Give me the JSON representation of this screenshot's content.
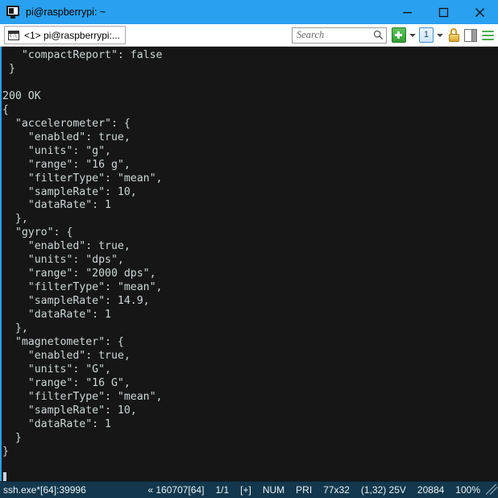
{
  "window": {
    "title": "pi@raspberrypi: ~",
    "icon": "conemu-monitor-icon",
    "minimize_label": "Minimize",
    "maximize_label": "Maximize",
    "close_label": "Close"
  },
  "tabs": [
    {
      "label": "<1> pi@raspberrypi:...",
      "icon": "console-icon",
      "active": true
    }
  ],
  "toolbar": {
    "search": {
      "placeholder": "Search",
      "value": "",
      "icon": "search-icon"
    },
    "new_console_label": "+",
    "new_console_icon": "plus-icon",
    "new_console_caret_icon": "chevron-down-icon",
    "active_console_label": "1",
    "active_console_icon": "console-tile-icon",
    "active_console_caret_icon": "chevron-down-icon",
    "lock_icon": "padlock-icon",
    "panel_icon": "split-panel-icon",
    "menu_icon": "hamburger-menu-icon"
  },
  "terminal": {
    "background": "#161616",
    "foreground": "#cdd6d6",
    "lines": [
      "   \"compactReport\": false",
      " }",
      "",
      "200 OK",
      "{",
      "  \"accelerometer\": {",
      "    \"enabled\": true,",
      "    \"units\": \"g\",",
      "    \"range\": \"16 g\",",
      "    \"filterType\": \"mean\",",
      "    \"sampleRate\": 10,",
      "    \"dataRate\": 1",
      "  },",
      "  \"gyro\": {",
      "    \"enabled\": true,",
      "    \"units\": \"dps\",",
      "    \"range\": \"2000 dps\",",
      "    \"filterType\": \"mean\",",
      "    \"sampleRate\": 14.9,",
      "    \"dataRate\": 1",
      "  },",
      "  \"magnetometer\": {",
      "    \"enabled\": true,",
      "    \"units\": \"G\",",
      "    \"range\": \"16 G\",",
      "    \"filterType\": \"mean\",",
      "    \"sampleRate\": 10,",
      "    \"dataRate\": 1",
      "  }",
      "}",
      ""
    ]
  },
  "statusbar": {
    "process": "ssh.exe*[64]:39996",
    "cells": [
      "« 160707[64]",
      "1/1",
      "[+]",
      "NUM",
      "PRI",
      "77x32",
      "(1,32) 25V",
      "20884",
      "100%"
    ],
    "resize_grip_icon": "resize-grip-icon"
  },
  "colors": {
    "titlebar": "#2aa0f0",
    "terminal_bg": "#161616",
    "terminal_fg": "#cdd6d6",
    "statusbar_bg": "#13384d",
    "accent_green": "#4caf50",
    "accent_gold": "#d9a52a"
  }
}
